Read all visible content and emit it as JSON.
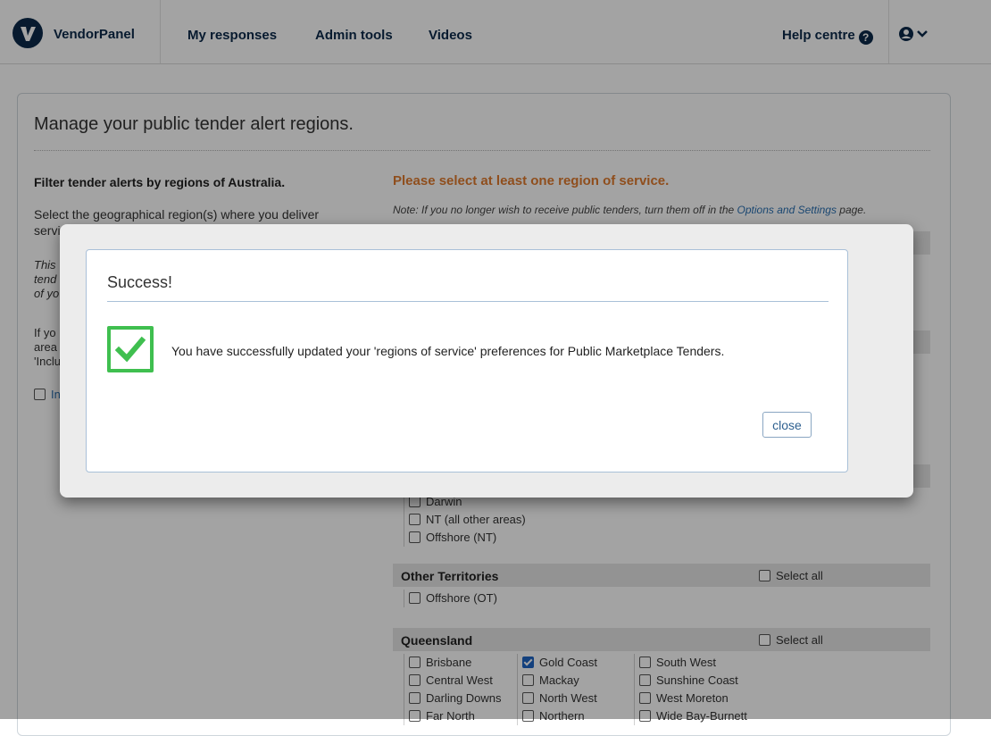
{
  "nav": {
    "brand": "VendorPanel",
    "links": [
      "My responses",
      "Admin tools",
      "Videos"
    ],
    "help": "Help centre"
  },
  "page": {
    "title": "Manage your public tender alert regions.",
    "left_heading": "Filter tender alerts by regions of Australia.",
    "left_text": "Select the geographical region(s) where you deliver",
    "left_text_cont": "servi",
    "frag_italic": [
      "This",
      "tend",
      "of yo"
    ],
    "frag_plain": [
      "If yo",
      "area",
      "'Inclu"
    ],
    "frag_link": "In",
    "warning": "Please select at least one region of service.",
    "note_prefix": "Note: If you no longer wish to receive public tenders, turn them off in the ",
    "note_link": "Options and Settings",
    "note_suffix": " page.",
    "select_all": "Select all"
  },
  "nt": {
    "items": [
      "Darwin",
      "NT (all other areas)",
      "Offshore (NT)"
    ]
  },
  "ot": {
    "title": "Other Territories",
    "items": [
      "Offshore (OT)"
    ]
  },
  "qld": {
    "title": "Queensland",
    "col1": [
      "Brisbane",
      "Central West",
      "Darling Downs",
      "Far North"
    ],
    "col2": [
      "Gold Coast",
      "Mackay",
      "North West",
      "Northern"
    ],
    "col3": [
      "South West",
      "Sunshine Coast",
      "West Moreton",
      "Wide Bay-Burnett"
    ]
  },
  "modal": {
    "title": "Success!",
    "message": "You have successfully updated your 'regions of service' preferences for Public Marketplace Tenders.",
    "close": "close"
  },
  "colors": {
    "navy": "#0b2a4a",
    "warning": "#e07b2e",
    "success_green": "#3fbf4f",
    "link": "#2a6fb1"
  },
  "icons": [
    "vendorpanel-logo-icon",
    "question-circle-icon",
    "user-circle-icon",
    "chevron-down-icon",
    "checkmark-icon"
  ]
}
